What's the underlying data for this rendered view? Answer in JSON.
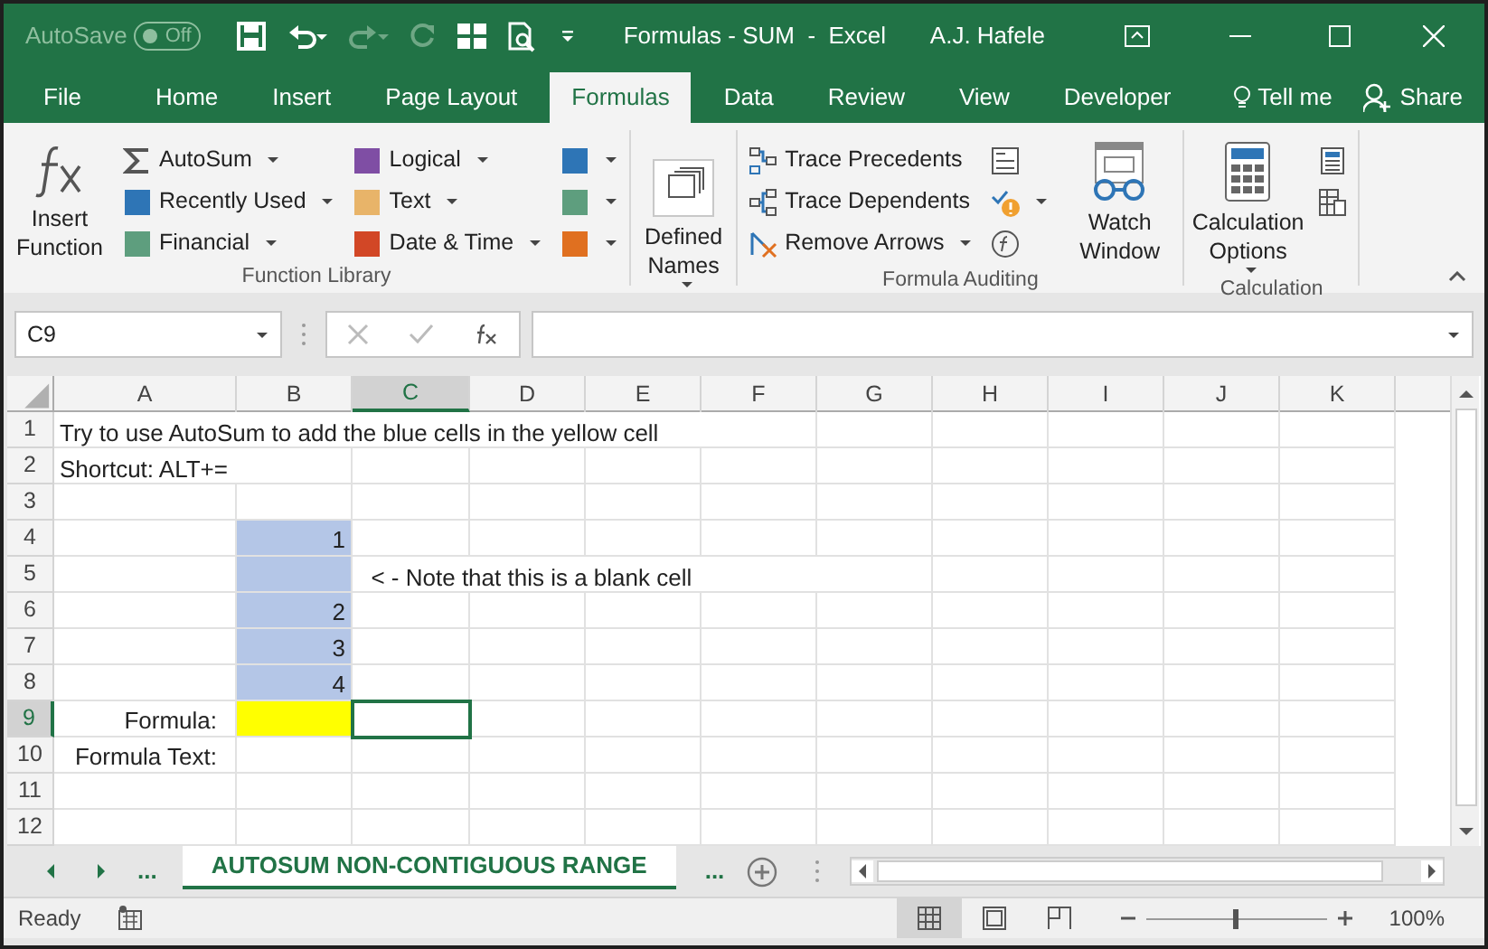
{
  "title_bar": {
    "autosave_label": "AutoSave",
    "autosave_state": "Off",
    "autosave_on": false,
    "title": "Formulas - SUM  -  Excel",
    "user": "A.J. Hafele"
  },
  "tabs": [
    {
      "label": "File",
      "selected": false
    },
    {
      "label": "Home",
      "selected": false
    },
    {
      "label": "Insert",
      "selected": false
    },
    {
      "label": "Page Layout",
      "selected": false
    },
    {
      "label": "Formulas",
      "selected": true
    },
    {
      "label": "Data",
      "selected": false
    },
    {
      "label": "Review",
      "selected": false
    },
    {
      "label": "View",
      "selected": false
    },
    {
      "label": "Developer",
      "selected": false
    }
  ],
  "tell_me": "Tell me",
  "share": "Share",
  "ribbon": {
    "groups": [
      {
        "label": "Function Library",
        "items": [
          {
            "kind": "large",
            "label": "Insert Function",
            "dropdown": false
          },
          {
            "kind": "column",
            "items": [
              {
                "label": "AutoSum",
                "dropdown": true
              },
              {
                "label": "Recently Used",
                "dropdown": true
              },
              {
                "label": "Financial",
                "dropdown": true
              }
            ]
          },
          {
            "kind": "column",
            "items": [
              {
                "label": "Logical",
                "dropdown": true
              },
              {
                "label": "Text",
                "dropdown": true
              },
              {
                "label": "Date & Time",
                "dropdown": true
              }
            ]
          },
          {
            "kind": "column",
            "items": [
              {
                "dropdown": true
              },
              {
                "dropdown": true
              },
              {
                "dropdown": true
              }
            ]
          }
        ]
      },
      {
        "items": [
          {
            "kind": "large",
            "label": "Defined Names",
            "dropdown": true
          }
        ]
      },
      {
        "label": "Formula Auditing",
        "items": [
          {
            "kind": "column",
            "items": [
              {
                "label": "Trace Precedents",
                "dropdown": false
              },
              {
                "label": "Trace Dependents",
                "dropdown": false
              },
              {
                "label": "Remove Arrows",
                "dropdown": true
              }
            ]
          },
          {
            "kind": "column",
            "items": [
              {
                "dropdown": false
              },
              {
                "dropdown": true
              },
              {
                "dropdown": false
              }
            ]
          },
          {
            "kind": "large",
            "label": "Watch Window",
            "dropdown": false
          }
        ]
      },
      {
        "label": "Calculation",
        "items": [
          {
            "kind": "large",
            "label": "Calculation Options",
            "dropdown": true
          },
          {
            "kind": "column",
            "items": [
              {
                "dropdown": false
              },
              {
                "dropdown": false
              }
            ]
          }
        ]
      }
    ]
  },
  "formula_bar": {
    "name_box": "C9"
  },
  "sheet": {
    "columns": [
      {
        "label": "A",
        "selected": false
      },
      {
        "label": "B",
        "selected": false
      },
      {
        "label": "C",
        "selected": true
      },
      {
        "label": "D",
        "selected": false
      },
      {
        "label": "E",
        "selected": false
      },
      {
        "label": "F",
        "selected": false
      },
      {
        "label": "G",
        "selected": false
      },
      {
        "label": "H",
        "selected": false
      },
      {
        "label": "I",
        "selected": false
      },
      {
        "label": "J",
        "selected": false
      },
      {
        "label": "K",
        "selected": false
      }
    ],
    "rows": [
      {
        "label": "1",
        "selected": false,
        "cells": [
          {
            "text": "Try to use AutoSum to add the blue cells in the yellow cell"
          }
        ]
      },
      {
        "label": "2",
        "selected": false,
        "cells": [
          {
            "text": "Shortcut: ALT+="
          }
        ]
      },
      {
        "label": "3",
        "selected": false,
        "cells": []
      },
      {
        "label": "4",
        "selected": false,
        "cells": [
          {},
          {
            "text": "1",
            "kind": "number",
            "color": "#b4c6e7"
          }
        ]
      },
      {
        "label": "5",
        "selected": false,
        "cells": [
          {},
          {
            "color": "#b4c6e7"
          },
          {
            "text": "  < - Note that this is a blank cell"
          }
        ]
      },
      {
        "label": "6",
        "selected": false,
        "cells": [
          {},
          {
            "text": "2",
            "kind": "number",
            "color": "#b4c6e7"
          }
        ]
      },
      {
        "label": "7",
        "selected": false,
        "cells": [
          {},
          {
            "text": "3",
            "kind": "number",
            "color": "#b4c6e7"
          }
        ]
      },
      {
        "label": "8",
        "selected": false,
        "cells": [
          {},
          {
            "text": "4",
            "kind": "number",
            "color": "#b4c6e7"
          }
        ]
      },
      {
        "label": "9",
        "selected": true,
        "cells": [
          {
            "text": "Formula:",
            "kind": "label"
          },
          {
            "color": "#ffff00"
          }
        ]
      },
      {
        "label": "10",
        "selected": false,
        "cells": [
          {
            "text": "Formula Text:",
            "kind": "label"
          }
        ]
      },
      {
        "label": "11",
        "selected": false,
        "cells": []
      },
      {
        "label": "12",
        "selected": false,
        "cells": []
      }
    ]
  },
  "sheet_tabs": {
    "more_left": "...",
    "tabs": [
      {
        "label": "AUTOSUM NON-CONTIGUOUS RANGE",
        "selected": true
      }
    ],
    "more_right": "..."
  },
  "status_bar": {
    "status": "Ready",
    "views": [
      {
        "selected": true
      },
      {
        "selected": false
      },
      {
        "selected": false
      }
    ],
    "zoom_slider": {
      "level": 0.5
    },
    "zoom": "100%"
  }
}
